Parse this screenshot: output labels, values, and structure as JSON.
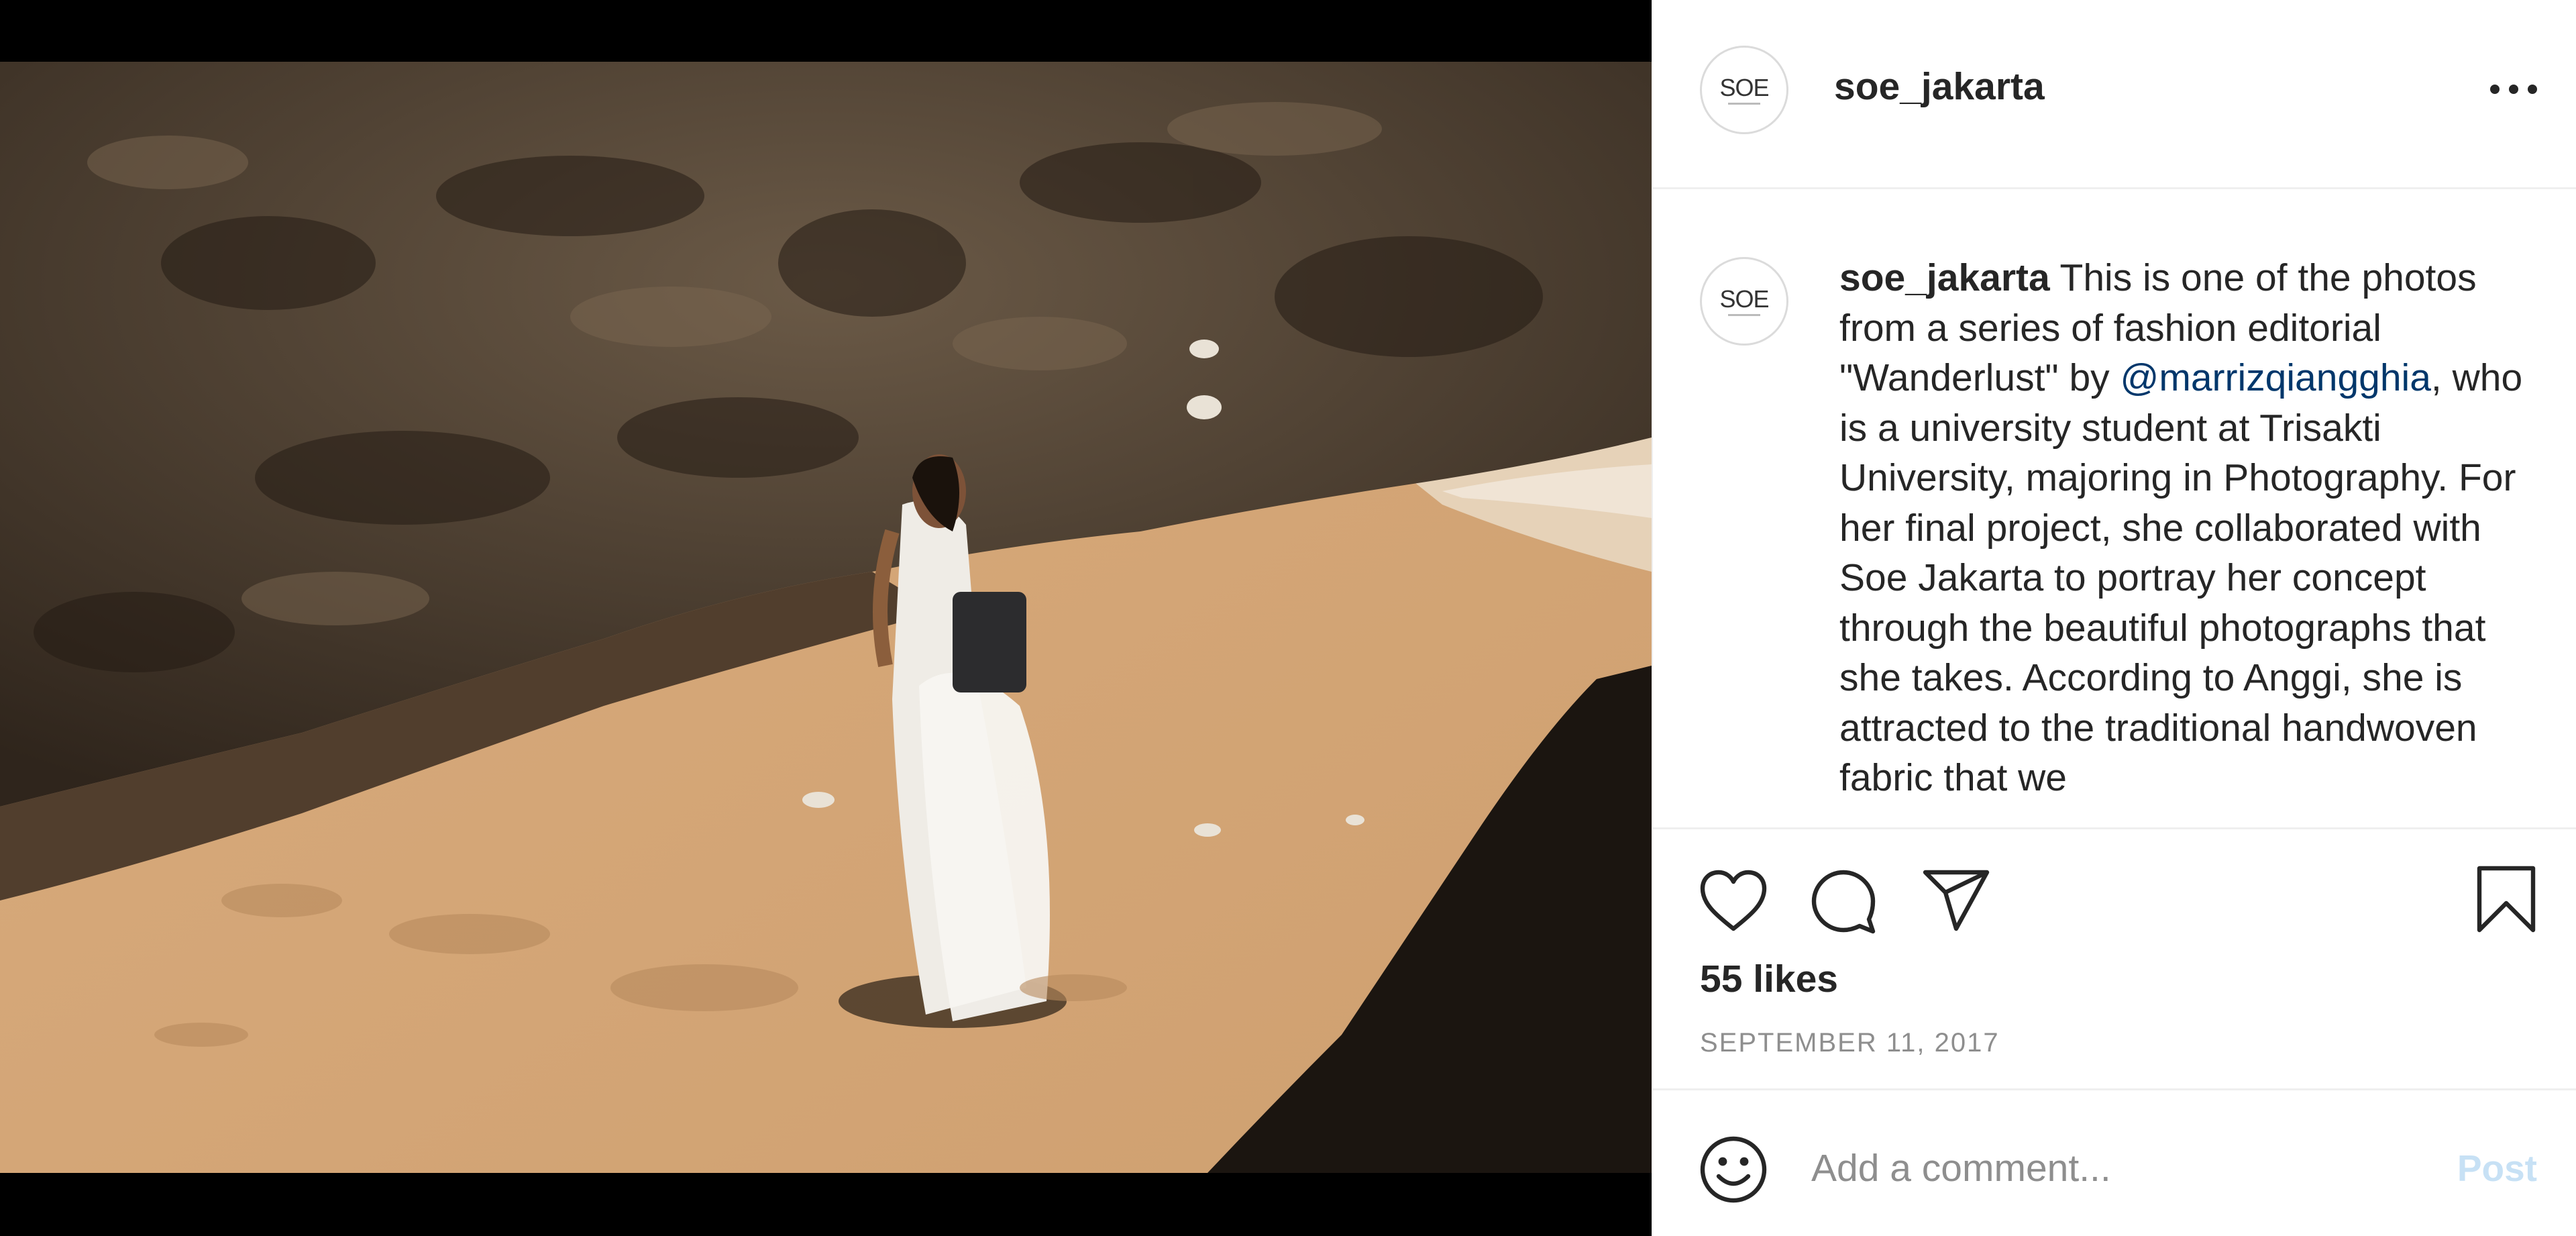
{
  "post": {
    "username": "soe_jakarta",
    "avatar_text": "SOE",
    "photo_alt": "Model in white dress on sandy beach beneath rock cliff"
  },
  "caption": {
    "username": "soe_jakarta",
    "text_before_mention": " This is one of the photos from a series of fashion editorial \"Wanderlust\" by ",
    "mention": "@marrizqiangghia",
    "text_after_mention": ", who is a university student at Trisakti University, majoring in Photography. For her final project, she collaborated with Soe Jakarta to portray her concept through the beautiful photographs that she takes. According to Anggi, she is attracted to the traditional handwoven fabric that we"
  },
  "actions": {
    "icons": [
      "heart-icon",
      "comment-icon",
      "share-icon",
      "bookmark-icon"
    ],
    "likes": "55 likes",
    "date": "SEPTEMBER 11, 2017"
  },
  "comment": {
    "placeholder": "Add a comment...",
    "post_label": "Post",
    "emoji_icon": "smiley-icon"
  },
  "colors": {
    "mention": "#00376b",
    "post_disabled": "#c7e1f5",
    "muted": "#8e8e8e",
    "divider": "#efefef"
  }
}
